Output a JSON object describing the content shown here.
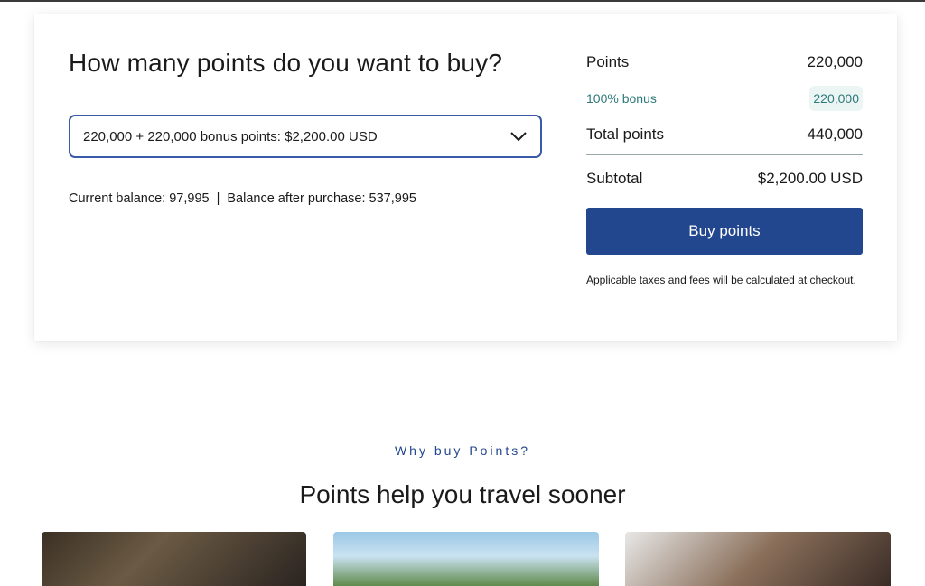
{
  "purchase": {
    "heading": "How many points do you want to buy?",
    "select_value": "220,000 + 220,000 bonus points: $2,200.00 USD",
    "balance": {
      "current": "Current balance: 97,995",
      "separator": "|",
      "after": "Balance after purchase: 537,995"
    }
  },
  "summary": {
    "points_label": "Points",
    "points_value": "220,000",
    "bonus_label": "100% bonus",
    "bonus_value": "220,000",
    "total_label": "Total points",
    "total_value": "440,000",
    "subtotal_label": "Subtotal",
    "subtotal_value": "$2,200.00 USD",
    "buy_button": "Buy points",
    "note": "Applicable taxes and fees will be calculated at checkout."
  },
  "why": {
    "eyebrow": "Why buy Points?",
    "title": "Points help you travel sooner"
  },
  "icons": {
    "select_caret": "chevron-down-icon"
  },
  "colors": {
    "accent": "#22478e",
    "select_border": "#3a5ba8",
    "bonus_text": "#2f7a7a",
    "bonus_bg": "#eaf5f4"
  }
}
